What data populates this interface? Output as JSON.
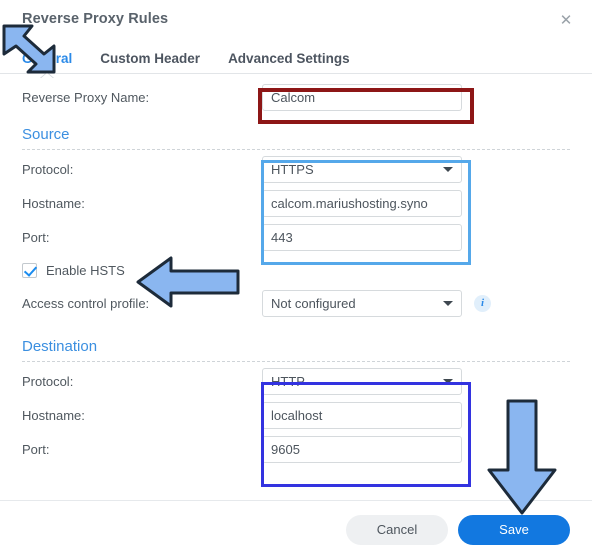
{
  "window": {
    "title": "Reverse Proxy Rules",
    "close_label": "✕",
    "close_icon": "close-icon"
  },
  "tabs": [
    {
      "label": "General",
      "active": true
    },
    {
      "label": "Custom Header",
      "active": false
    },
    {
      "label": "Advanced Settings",
      "active": false
    }
  ],
  "form": {
    "name_row": {
      "label": "Reverse Proxy Name:",
      "value": "Calcom"
    },
    "source": {
      "title": "Source",
      "protocol_label": "Protocol:",
      "protocol_value": "HTTPS",
      "hostname_label": "Hostname:",
      "hostname_value": "calcom.mariushosting.syno",
      "port_label": "Port:",
      "port_value": "443",
      "hsts_label": "Enable HSTS",
      "hsts_checked": true,
      "acl_label": "Access control profile:",
      "acl_value": "Not configured",
      "info_icon": "info-icon",
      "info_glyph": "i"
    },
    "destination": {
      "title": "Destination",
      "protocol_label": "Protocol:",
      "protocol_value": "HTTP",
      "hostname_label": "Hostname:",
      "hostname_value": "localhost",
      "port_label": "Port:",
      "port_value": "9605"
    }
  },
  "footer": {
    "cancel_label": "Cancel",
    "save_label": "Save"
  },
  "annotations": {
    "arrow_color": "#8ab6f0",
    "arrow_outline": "#1d2b3a",
    "highlight_name_color": "#8d1616",
    "highlight_source_color": "#55a8ea",
    "highlight_destination_color": "#3333e0"
  }
}
